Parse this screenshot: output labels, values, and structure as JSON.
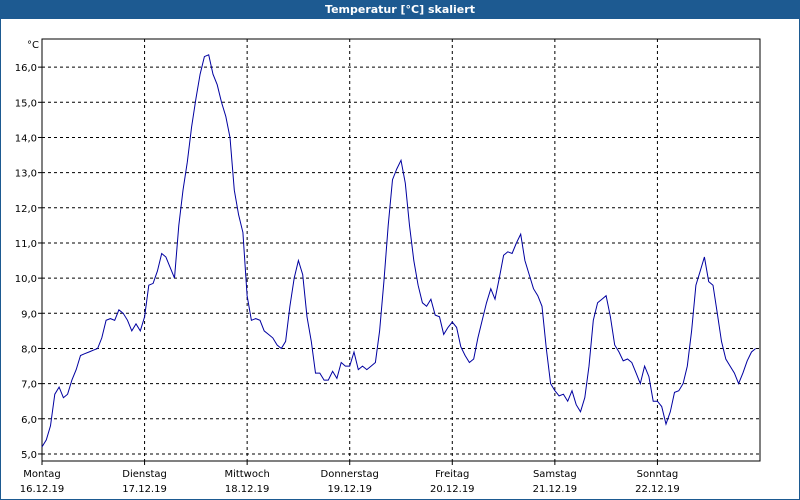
{
  "window": {
    "title": "Temperatur [°C] skaliert"
  },
  "chart_data": {
    "type": "line",
    "title": "Temperatur [°C] skaliert",
    "ylabel": "°C",
    "ylim": [
      4.8,
      16.8
    ],
    "xlim": [
      0,
      168
    ],
    "y_ticks": [
      "5,0",
      "6,0",
      "7,0",
      "8,0",
      "9,0",
      "10,0",
      "11,0",
      "12,0",
      "13,0",
      "14,0",
      "15,0",
      "16,0"
    ],
    "y_tick_values": [
      5,
      6,
      7,
      8,
      9,
      10,
      11,
      12,
      13,
      14,
      15,
      16
    ],
    "x_ticks": [
      {
        "day": "Montag",
        "date": "16.12.19",
        "hour": 0
      },
      {
        "day": "Dienstag",
        "date": "17.12.19",
        "hour": 24
      },
      {
        "day": "Mittwoch",
        "date": "18.12.19",
        "hour": 48
      },
      {
        "day": "Donnerstag",
        "date": "19.12.19",
        "hour": 72
      },
      {
        "day": "Freitag",
        "date": "20.12.19",
        "hour": 96
      },
      {
        "day": "Samstag",
        "date": "21.12.19",
        "hour": 120
      },
      {
        "day": "Sonntag",
        "date": "22.12.19",
        "hour": 144
      }
    ],
    "grid": true,
    "series": [
      {
        "color": "#0000a0",
        "points": [
          [
            0,
            5.2
          ],
          [
            1,
            5.4
          ],
          [
            2,
            5.8
          ],
          [
            3,
            6.7
          ],
          [
            4,
            6.9
          ],
          [
            5,
            6.6
          ],
          [
            6,
            6.7
          ],
          [
            7,
            7.1
          ],
          [
            8,
            7.4
          ],
          [
            9,
            7.8
          ],
          [
            10,
            7.85
          ],
          [
            11,
            7.9
          ],
          [
            12,
            7.95
          ],
          [
            13,
            8.0
          ],
          [
            14,
            8.3
          ],
          [
            15,
            8.8
          ],
          [
            16,
            8.85
          ],
          [
            17,
            8.8
          ],
          [
            18,
            9.1
          ],
          [
            19,
            9.0
          ],
          [
            20,
            8.8
          ],
          [
            21,
            8.5
          ],
          [
            22,
            8.7
          ],
          [
            23,
            8.5
          ],
          [
            24,
            8.9
          ],
          [
            25,
            9.8
          ],
          [
            26,
            9.85
          ],
          [
            27,
            10.2
          ],
          [
            28,
            10.7
          ],
          [
            29,
            10.6
          ],
          [
            30,
            10.3
          ],
          [
            31,
            10.0
          ],
          [
            32,
            11.5
          ],
          [
            33,
            12.5
          ],
          [
            34,
            13.3
          ],
          [
            35,
            14.3
          ],
          [
            36,
            15.1
          ],
          [
            37,
            15.8
          ],
          [
            38,
            16.3
          ],
          [
            39,
            16.35
          ],
          [
            40,
            15.8
          ],
          [
            41,
            15.5
          ],
          [
            42,
            15.0
          ],
          [
            43,
            14.6
          ],
          [
            44,
            14.0
          ],
          [
            45,
            12.5
          ],
          [
            46,
            11.8
          ],
          [
            47,
            11.3
          ],
          [
            48,
            9.5
          ],
          [
            49,
            8.8
          ],
          [
            50,
            8.85
          ],
          [
            51,
            8.8
          ],
          [
            52,
            8.5
          ],
          [
            53,
            8.4
          ],
          [
            54,
            8.3
          ],
          [
            55,
            8.1
          ],
          [
            56,
            8.0
          ],
          [
            57,
            8.2
          ],
          [
            58,
            9.2
          ],
          [
            59,
            10.0
          ],
          [
            60,
            10.5
          ],
          [
            61,
            10.1
          ],
          [
            62,
            8.9
          ],
          [
            63,
            8.2
          ],
          [
            64,
            7.3
          ],
          [
            65,
            7.3
          ],
          [
            66,
            7.1
          ],
          [
            67,
            7.1
          ],
          [
            68,
            7.35
          ],
          [
            69,
            7.15
          ],
          [
            70,
            7.6
          ],
          [
            71,
            7.5
          ],
          [
            72,
            7.5
          ],
          [
            73,
            7.9
          ],
          [
            74,
            7.4
          ],
          [
            75,
            7.5
          ],
          [
            76,
            7.4
          ],
          [
            77,
            7.5
          ],
          [
            78,
            7.6
          ],
          [
            79,
            8.5
          ],
          [
            80,
            9.9
          ],
          [
            81,
            11.5
          ],
          [
            82,
            12.8
          ],
          [
            83,
            13.1
          ],
          [
            84,
            13.35
          ],
          [
            85,
            12.7
          ],
          [
            86,
            11.5
          ],
          [
            87,
            10.5
          ],
          [
            88,
            9.8
          ],
          [
            89,
            9.3
          ],
          [
            90,
            9.2
          ],
          [
            91,
            9.4
          ],
          [
            92,
            8.95
          ],
          [
            93,
            8.9
          ],
          [
            94,
            8.4
          ],
          [
            95,
            8.6
          ],
          [
            96,
            8.75
          ],
          [
            97,
            8.6
          ],
          [
            98,
            8.05
          ],
          [
            99,
            7.8
          ],
          [
            100,
            7.6
          ],
          [
            101,
            7.7
          ],
          [
            102,
            8.3
          ],
          [
            103,
            8.8
          ],
          [
            104,
            9.3
          ],
          [
            105,
            9.7
          ],
          [
            106,
            9.4
          ],
          [
            107,
            10.0
          ],
          [
            108,
            10.65
          ],
          [
            109,
            10.75
          ],
          [
            110,
            10.7
          ],
          [
            111,
            11.0
          ],
          [
            112,
            11.25
          ],
          [
            113,
            10.5
          ],
          [
            114,
            10.1
          ],
          [
            115,
            9.7
          ],
          [
            116,
            9.5
          ],
          [
            117,
            9.2
          ],
          [
            118,
            8.0
          ],
          [
            119,
            7.0
          ],
          [
            120,
            6.8
          ],
          [
            121,
            6.65
          ],
          [
            122,
            6.7
          ],
          [
            123,
            6.5
          ],
          [
            124,
            6.8
          ],
          [
            125,
            6.4
          ],
          [
            126,
            6.2
          ],
          [
            127,
            6.6
          ],
          [
            128,
            7.5
          ],
          [
            129,
            8.8
          ],
          [
            130,
            9.3
          ],
          [
            131,
            9.4
          ],
          [
            132,
            9.5
          ],
          [
            133,
            8.9
          ],
          [
            134,
            8.1
          ],
          [
            135,
            7.9
          ],
          [
            136,
            7.65
          ],
          [
            137,
            7.7
          ],
          [
            138,
            7.6
          ],
          [
            139,
            7.3
          ],
          [
            140,
            7.0
          ],
          [
            141,
            7.5
          ],
          [
            142,
            7.2
          ],
          [
            143,
            6.5
          ],
          [
            144,
            6.5
          ],
          [
            145,
            6.35
          ],
          [
            146,
            5.85
          ],
          [
            147,
            6.2
          ],
          [
            148,
            6.75
          ],
          [
            149,
            6.8
          ],
          [
            150,
            7.0
          ],
          [
            151,
            7.5
          ],
          [
            152,
            8.5
          ],
          [
            153,
            9.8
          ],
          [
            154,
            10.2
          ],
          [
            155,
            10.6
          ],
          [
            156,
            9.9
          ],
          [
            157,
            9.8
          ],
          [
            158,
            9.0
          ],
          [
            159,
            8.2
          ],
          [
            160,
            7.7
          ],
          [
            161,
            7.5
          ],
          [
            162,
            7.3
          ],
          [
            163,
            7.0
          ],
          [
            164,
            7.3
          ],
          [
            165,
            7.65
          ],
          [
            166,
            7.9
          ],
          [
            167,
            8.0
          ]
        ]
      }
    ]
  }
}
